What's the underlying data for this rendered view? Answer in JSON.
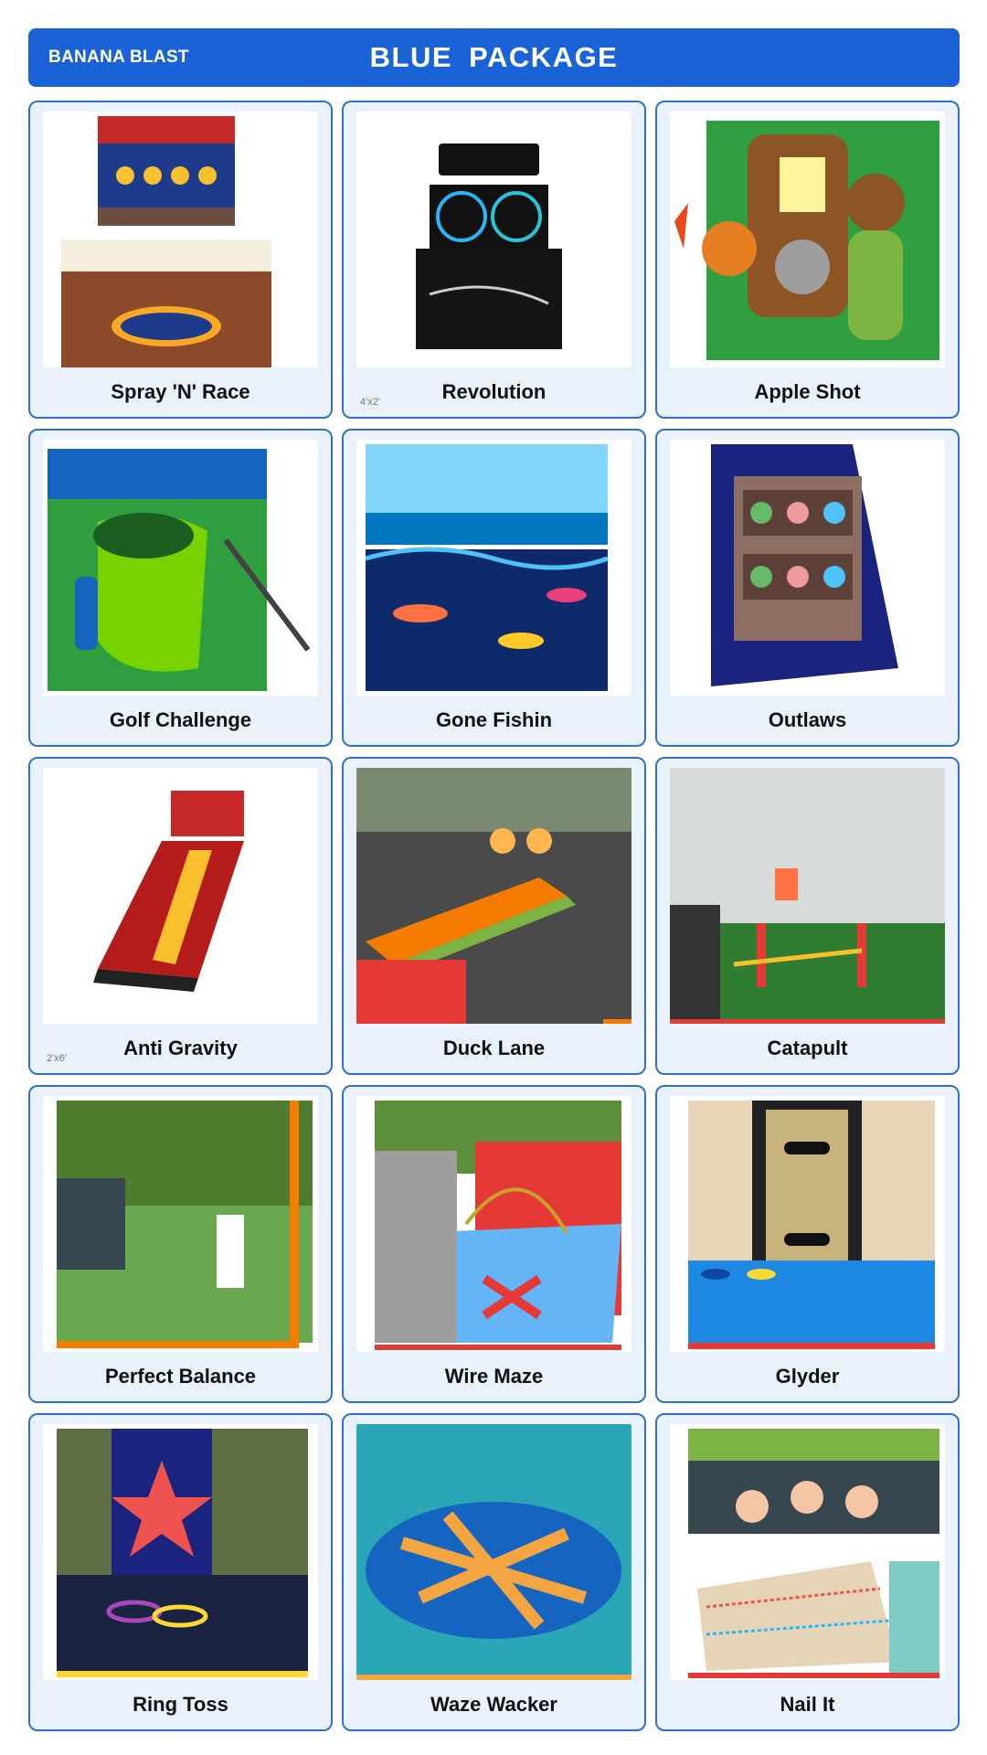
{
  "header": {
    "brand": "BANANA BLAST",
    "title": "BLUE  PACKAGE"
  },
  "colors": {
    "accent": "#1a63d6",
    "card_bg": "#e9f1fb",
    "card_border": "#2f6fd0"
  },
  "games": [
    {
      "label": "Spray 'N' Race",
      "icon": "spray-n-race-game-photo"
    },
    {
      "label": "Revolution",
      "icon": "revolution-game-photo",
      "size_note": "4'x2'"
    },
    {
      "label": "Apple Shot",
      "icon": "apple-shot-game-photo"
    },
    {
      "label": "Golf Challenge",
      "icon": "golf-challenge-game-photo"
    },
    {
      "label": "Gone Fishin",
      "icon": "gone-fishin-game-photo"
    },
    {
      "label": "Outlaws",
      "icon": "outlaws-game-photo"
    },
    {
      "label": "Anti Gravity",
      "icon": "anti-gravity-game-photo",
      "size_note": "2'x6'"
    },
    {
      "label": "Duck Lane",
      "icon": "duck-lane-game-photo"
    },
    {
      "label": "Catapult",
      "icon": "catapult-game-photo"
    },
    {
      "label": "Perfect Balance",
      "icon": "perfect-balance-game-photo"
    },
    {
      "label": "Wire Maze",
      "icon": "wire-maze-game-photo"
    },
    {
      "label": "Glyder",
      "icon": "glyder-game-photo"
    },
    {
      "label": "Ring Toss",
      "icon": "ring-toss-game-photo"
    },
    {
      "label": "Waze Wacker",
      "icon": "waze-wacker-game-photo"
    },
    {
      "label": "Nail It",
      "icon": "nail-it-game-photo"
    }
  ]
}
